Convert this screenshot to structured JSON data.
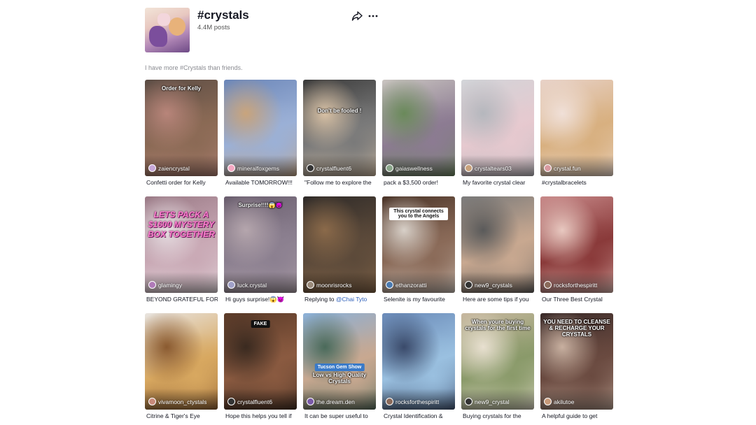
{
  "header": {
    "title": "#crystals",
    "posts": "4.4M posts",
    "description": "I have more #Crystals than friends."
  },
  "videos": [
    {
      "author": "zaiencrystal",
      "caption": "Confetti order for Kelly",
      "overlay": "Order for Kelly",
      "colors": [
        "#5b4c44",
        "#8b6a55",
        "#b8857a"
      ],
      "avatar": "#c7a7d8"
    },
    {
      "author": "mineralfoxgems",
      "caption": "Available TOMORROW!!!",
      "overlay": "",
      "colors": [
        "#6b86b8",
        "#9bb0d6",
        "#c9a47c"
      ],
      "avatar": "#f4a7c2"
    },
    {
      "author": "crystalfluent6",
      "caption": "\"Follow me to explore the",
      "overlay": "Don't be fooled !",
      "colors": [
        "#3a3a3a",
        "#7a7a7a",
        "#d9c2a6"
      ],
      "avatar": "#333333"
    },
    {
      "author": "gaiaswellness",
      "caption": "pack a $3,500 order!",
      "overlay": "",
      "colors": [
        "#c9c4c0",
        "#8c7b92",
        "#6a8a5a"
      ],
      "avatar": "#8aa68a"
    },
    {
      "author": "crystaltears03",
      "caption": "My favorite crystal clear",
      "overlay": "",
      "colors": [
        "#d2d4d8",
        "#e6c9cf",
        "#b5b7bd"
      ],
      "avatar": "#c9a27c"
    },
    {
      "author": "crystal.fun",
      "caption": "#crystalbracelets",
      "caption_highlight": true,
      "overlay": "",
      "colors": [
        "#e8d2c8",
        "#d8b080",
        "#f0e0d8"
      ],
      "avatar": "#d99aa0"
    },
    {
      "author": "glamingy",
      "caption": "BEYOND GRATEFUL FOR",
      "overlay": "LETS PACK A $1600 MYSTERY BOX TOGETHER",
      "overlay_style": "pink",
      "colors": [
        "#9a7a86",
        "#c9a9b5",
        "#e8e0e4"
      ],
      "avatar": "#b07ab8"
    },
    {
      "author": "luck.crystal",
      "caption": "Hi guys surprise!😱😈",
      "overlay": "Surprise!!!!😱😈",
      "colors": [
        "#6a5e6e",
        "#8c8090",
        "#b5a6ad"
      ],
      "avatar": "#a0a0c8"
    },
    {
      "author": "moonrisrocks",
      "caption": "Replying to @Chai Tyto",
      "caption_highlight_part": "@Chai Tyto",
      "caption_prefix": "Replying to ",
      "overlay": "",
      "colors": [
        "#2e2a28",
        "#5c4a3a",
        "#8b6a4a"
      ],
      "avatar": "#9a8a7a"
    },
    {
      "author": "ethanzoratti",
      "caption": "Selenite is my favourite",
      "overlay": "This crystal connects you to the Angels",
      "overlay_style": "white",
      "colors": [
        "#4a3428",
        "#8a6a58",
        "#d8d0c8"
      ],
      "avatar": "#4a7ab0"
    },
    {
      "author": "new9_crystals",
      "caption": "Here are some tips if you",
      "overlay": "",
      "colors": [
        "#7a7a7a",
        "#c8a890",
        "#5a5a5a"
      ],
      "avatar": "#333333"
    },
    {
      "author": "rocksforthespiritt",
      "caption": "Our Three Best Crystal",
      "overlay": "",
      "colors": [
        "#c88a8a",
        "#8a3a3a",
        "#e8c8c0"
      ],
      "avatar": "#8a6a5a"
    },
    {
      "author": "vivamoon_ctystals",
      "caption": "Citrine & Tiger's Eye",
      "overlay": "",
      "colors": [
        "#e8e4e0",
        "#d8a860",
        "#8a5a30"
      ],
      "avatar": "#c88a7a"
    },
    {
      "author": "crystalfluent6",
      "caption": "Hope this helps you tell if",
      "overlay": "FAKE",
      "overlay_style": "black",
      "colors": [
        "#5a3a28",
        "#8a5a40",
        "#3a2a20"
      ],
      "avatar": "#333333"
    },
    {
      "author": "the.dream.den",
      "caption": "It can be super useful to",
      "overlay": "Low vs High Quality Crystals",
      "badge": "Tucson Gem Show",
      "colors": [
        "#8ab0d8",
        "#c8a890",
        "#4a6a5a"
      ],
      "avatar": "#7a5aa8"
    },
    {
      "author": "rocksforthespiritt",
      "caption": "Crystal Identification &",
      "overlay": "",
      "colors": [
        "#6a8ab8",
        "#9ac0e0",
        "#3a4a6a"
      ],
      "avatar": "#8a6a5a"
    },
    {
      "author": "new9_crystal",
      "caption": "Buying crystals for the",
      "overlay": "When youre buying crystals for the first time",
      "colors": [
        "#c8b8a0",
        "#8a9a6a",
        "#e8e0d0"
      ],
      "avatar": "#333333"
    },
    {
      "author": "akilutoe",
      "caption": "A helpful guide to get",
      "overlay": "YOU NEED TO CLEANSE & RECHARGE YOUR CRYSTALS",
      "colors": [
        "#3a2a28",
        "#6a4a40",
        "#c8b0a0"
      ],
      "avatar": "#c89a7a"
    }
  ],
  "icons": {
    "share": "share-icon",
    "more": "more-icon"
  }
}
